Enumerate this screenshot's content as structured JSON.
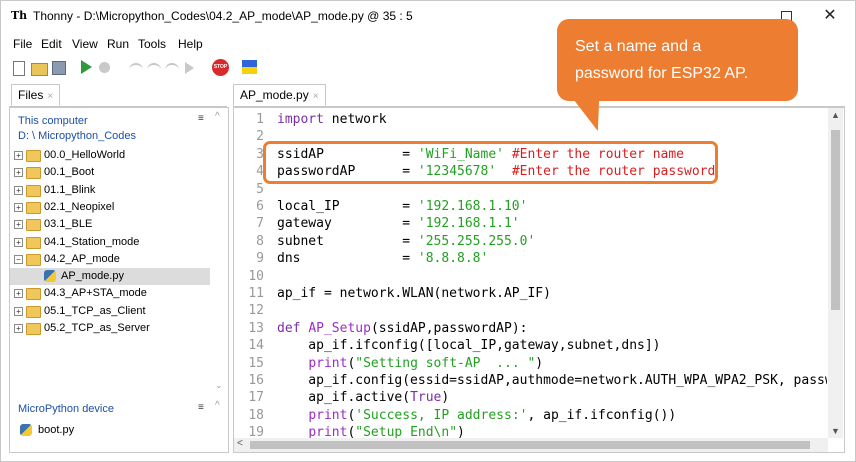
{
  "window": {
    "title": "Thonny  -  D:\\Micropython_Codes\\04.2_AP_mode\\AP_mode.py  @  35 : 5",
    "app_icon": "Th"
  },
  "menu": [
    "File",
    "Edit",
    "View",
    "Run",
    "Tools",
    "Help"
  ],
  "toolbar_icons": [
    "new-file-icon",
    "open-folder-icon",
    "save-icon",
    "run-icon",
    "debug-icon",
    "step-over-icon",
    "step-into-icon",
    "step-out-icon",
    "resume-icon",
    "stop-icon",
    "flag-icon"
  ],
  "stop_text": "STOP",
  "files_panel": {
    "tab_label": "Files",
    "tab_close": "×",
    "computer_title": "This computer",
    "computer_path": "D: \\ Micropython_Codes",
    "tree": [
      {
        "label": "00.0_HelloWorld",
        "expander": "+",
        "type": "folder"
      },
      {
        "label": "00.1_Boot",
        "expander": "+",
        "type": "folder"
      },
      {
        "label": "01.1_Blink",
        "expander": "+",
        "type": "folder"
      },
      {
        "label": "02.1_Neopixel",
        "expander": "+",
        "type": "folder"
      },
      {
        "label": "03.1_BLE",
        "expander": "+",
        "type": "folder"
      },
      {
        "label": "04.1_Station_mode",
        "expander": "+",
        "type": "folder"
      },
      {
        "label": "04.2_AP_mode",
        "expander": "−",
        "type": "folder"
      },
      {
        "label": "AP_mode.py",
        "expander": "",
        "type": "python-file",
        "selected": true
      },
      {
        "label": "04.3_AP+STA_mode",
        "expander": "+",
        "type": "folder"
      },
      {
        "label": "05.1_TCP_as_Client",
        "expander": "+",
        "type": "folder"
      },
      {
        "label": "05.2_TCP_as_Server",
        "expander": "+",
        "type": "folder"
      }
    ],
    "device_title": "MicroPython device",
    "device_files": [
      "boot.py"
    ]
  },
  "editor": {
    "tab_label": "AP_mode.py",
    "tab_close": "×",
    "line_numbers": [
      "1",
      "2",
      "3",
      "4",
      "5",
      "6",
      "7",
      "8",
      "9",
      "10",
      "11",
      "12",
      "13",
      "14",
      "15",
      "16",
      "17",
      "18",
      "19"
    ],
    "lines": [
      [
        {
          "t": "import",
          "c": "kw"
        },
        {
          "t": " network"
        }
      ],
      [],
      [
        {
          "t": "ssidAP          = "
        },
        {
          "t": "'WiFi_Name'",
          "c": "str"
        },
        {
          "t": " "
        },
        {
          "t": "#Enter the router name",
          "c": "cmt"
        }
      ],
      [
        {
          "t": "passwordAP      = "
        },
        {
          "t": "'12345678'",
          "c": "str"
        },
        {
          "t": "  "
        },
        {
          "t": "#Enter the router password",
          "c": "cmt"
        }
      ],
      [],
      [
        {
          "t": "local_IP        = "
        },
        {
          "t": "'192.168.1.10'",
          "c": "str"
        }
      ],
      [
        {
          "t": "gateway         = "
        },
        {
          "t": "'192.168.1.1'",
          "c": "str"
        }
      ],
      [
        {
          "t": "subnet          = "
        },
        {
          "t": "'255.255.255.0'",
          "c": "str"
        }
      ],
      [
        {
          "t": "dns             = "
        },
        {
          "t": "'8.8.8.8'",
          "c": "str"
        }
      ],
      [],
      [
        {
          "t": "ap_if = network.WLAN(network.AP_IF)"
        }
      ],
      [],
      [
        {
          "t": "def",
          "c": "kw"
        },
        {
          "t": " "
        },
        {
          "t": "AP_Setup",
          "c": "bi"
        },
        {
          "t": "(ssidAP,passwordAP):"
        }
      ],
      [
        {
          "t": "    ap_if.ifconfig([local_IP,gateway,subnet,dns])"
        }
      ],
      [
        {
          "t": "    "
        },
        {
          "t": "print",
          "c": "bi"
        },
        {
          "t": "("
        },
        {
          "t": "\"Setting soft-AP  ... \"",
          "c": "str"
        },
        {
          "t": ")"
        }
      ],
      [
        {
          "t": "    ap_if.config(essid=ssidAP,authmode=network.AUTH_WPA_WPA2_PSK, passw"
        }
      ],
      [
        {
          "t": "    ap_if.active("
        },
        {
          "t": "True",
          "c": "kw"
        },
        {
          "t": ")"
        }
      ],
      [
        {
          "t": "    "
        },
        {
          "t": "print",
          "c": "bi"
        },
        {
          "t": "("
        },
        {
          "t": "'Success, IP address:'",
          "c": "str"
        },
        {
          "t": ", ap_if.ifconfig())"
        }
      ],
      [
        {
          "t": "    "
        },
        {
          "t": "print",
          "c": "bi"
        },
        {
          "t": "("
        },
        {
          "t": "\"Setup End\\n\"",
          "c": "str"
        },
        {
          "t": ")"
        }
      ]
    ]
  },
  "callout": {
    "line1": "Set a name and a",
    "line2": "password for ESP32 AP."
  },
  "colors": {
    "callout": "#ed7d31",
    "keyword": "#7a2ea8",
    "string": "#23a023",
    "comment": "#d61f1f"
  }
}
